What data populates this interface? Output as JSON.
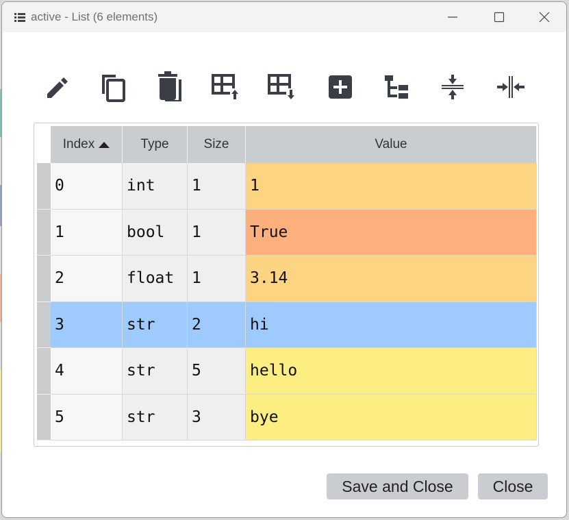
{
  "window": {
    "title": "active - List (6 elements)"
  },
  "toolbar": {
    "icons": [
      "edit-icon",
      "copy-icon",
      "delete-icon",
      "insert-row-above-icon",
      "insert-row-below-icon",
      "add-icon",
      "tree-view-icon",
      "collapse-vertical-icon",
      "collapse-horizontal-icon"
    ]
  },
  "table": {
    "headers": [
      "Index",
      "Type",
      "Size",
      "Value"
    ],
    "sort": {
      "column": "Index",
      "direction": "ascending"
    },
    "rows": [
      {
        "index": "0",
        "type": "int",
        "size": "1",
        "value": "1",
        "color": "#fdd481"
      },
      {
        "index": "1",
        "type": "bool",
        "size": "1",
        "value": "True",
        "color": "#fdb07c"
      },
      {
        "index": "2",
        "type": "float",
        "size": "1",
        "value": "3.14",
        "color": "#fdd481"
      },
      {
        "index": "3",
        "type": "str",
        "size": "2",
        "value": "hi",
        "color": "#fdee81"
      },
      {
        "index": "4",
        "type": "str",
        "size": "5",
        "value": "hello",
        "color": "#fdee81"
      },
      {
        "index": "5",
        "type": "str",
        "size": "3",
        "value": "bye",
        "color": "#fdee81"
      }
    ],
    "selected_row": 3,
    "selection_color": "#9fcafd"
  },
  "buttons": {
    "save_close": "Save and Close",
    "close": "Close"
  }
}
